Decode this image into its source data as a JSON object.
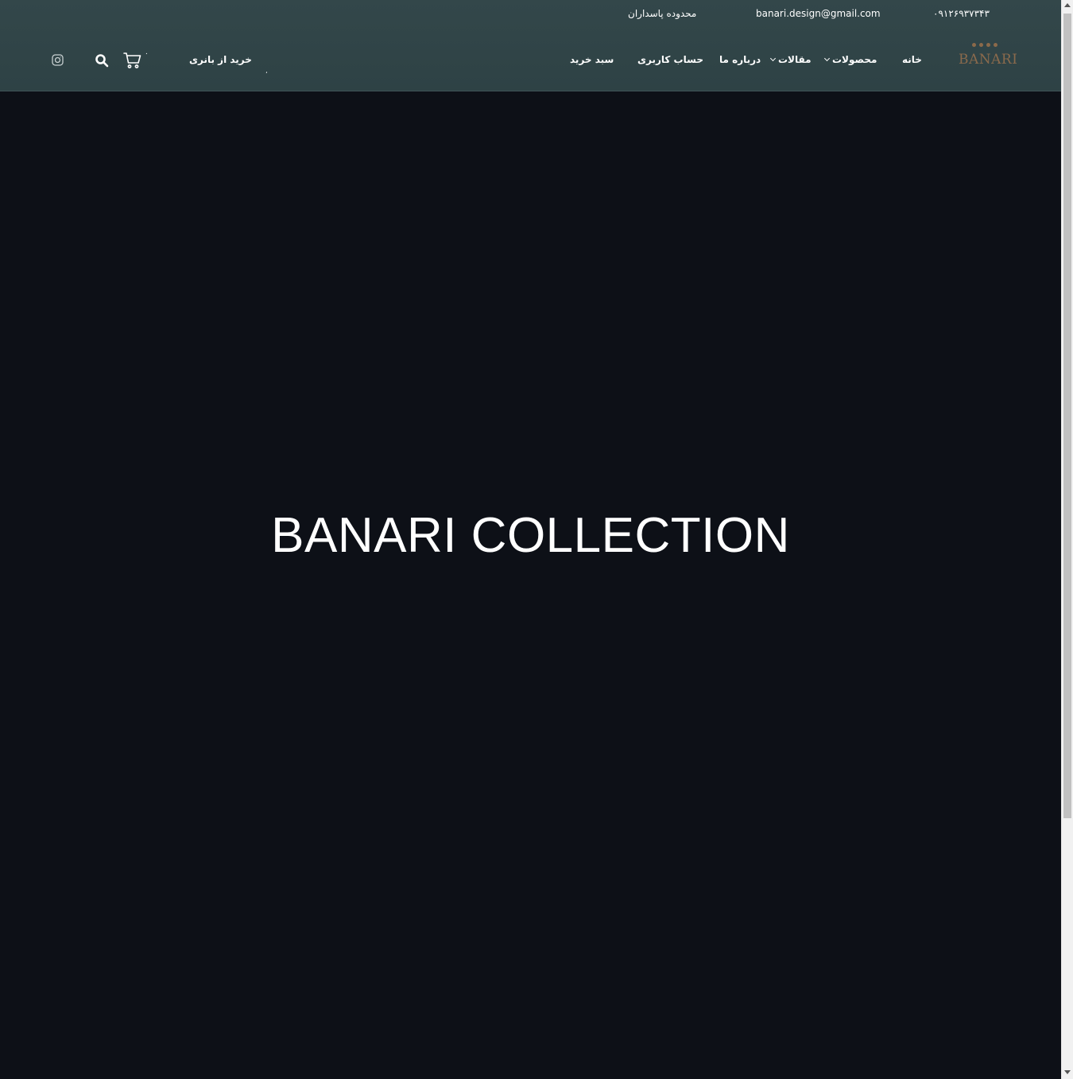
{
  "topbar": {
    "phone": "۰۹۱۲۶۹۳۷۳۴۳",
    "email": "banari.design@gmail.com",
    "address": "محدوده پاسداران"
  },
  "logo": {
    "text": "BANARI"
  },
  "nav": {
    "home": "خانه",
    "products": "محصولات",
    "articles": "مقالات",
    "about": "درباره ما",
    "account": "حساب کاربری",
    "cart": "سبد خرید"
  },
  "header_actions": {
    "small_mark": "،",
    "shop_link": "خرید از بانری",
    "cart_count": "۰"
  },
  "hero": {
    "title": "BANARI COLLECTION"
  },
  "colors": {
    "header_bg": "#33474a",
    "page_bg": "#0d1017",
    "logo_gold": "#8a6a4c",
    "text": "#ffffff"
  },
  "icons": {
    "cart": "cart-icon",
    "search": "search-icon",
    "instagram": "instagram-icon"
  }
}
